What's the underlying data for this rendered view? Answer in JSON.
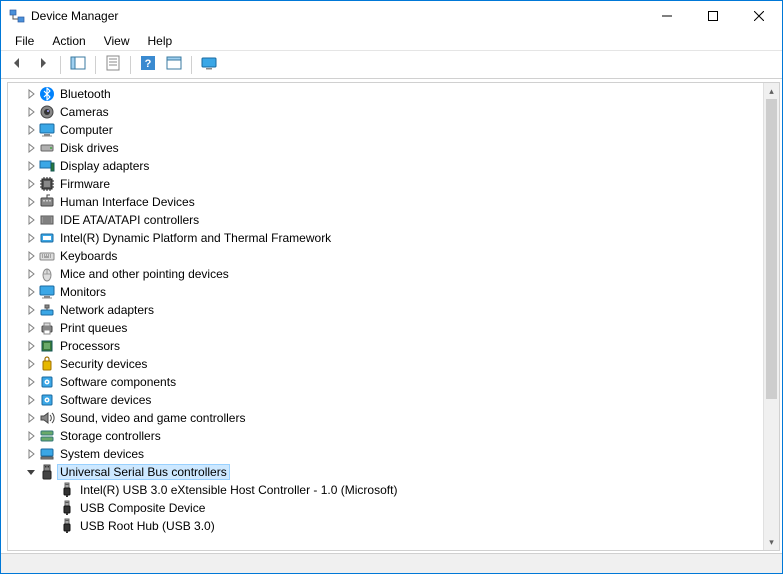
{
  "window": {
    "title": "Device Manager"
  },
  "menubar": {
    "items": [
      "File",
      "Action",
      "View",
      "Help"
    ]
  },
  "toolbar": {
    "buttons": [
      {
        "name": "back-button",
        "icon": "arrow-left-icon"
      },
      {
        "name": "forward-button",
        "icon": "arrow-right-icon"
      },
      {
        "name": "show-hide-tree-button",
        "icon": "panel-icon",
        "sep_before": true
      },
      {
        "name": "properties-button",
        "icon": "properties-icon",
        "sep_before": true
      },
      {
        "name": "help-button",
        "icon": "help-icon",
        "sep_before": true
      },
      {
        "name": "show-hidden-button",
        "icon": "show-hidden-icon"
      },
      {
        "name": "scan-button",
        "icon": "scan-icon",
        "sep_before": true
      }
    ]
  },
  "tree": {
    "nodes": [
      {
        "label": "Bluetooth",
        "icon": "bluetooth",
        "expandable": true,
        "expanded": false
      },
      {
        "label": "Cameras",
        "icon": "camera",
        "expandable": true,
        "expanded": false
      },
      {
        "label": "Computer",
        "icon": "monitor",
        "expandable": true,
        "expanded": false
      },
      {
        "label": "Disk drives",
        "icon": "disk",
        "expandable": true,
        "expanded": false
      },
      {
        "label": "Display adapters",
        "icon": "display-adapter",
        "expandable": true,
        "expanded": false
      },
      {
        "label": "Firmware",
        "icon": "chip",
        "expandable": true,
        "expanded": false
      },
      {
        "label": "Human Interface Devices",
        "icon": "hid",
        "expandable": true,
        "expanded": false
      },
      {
        "label": "IDE ATA/ATAPI controllers",
        "icon": "ide",
        "expandable": true,
        "expanded": false
      },
      {
        "label": "Intel(R) Dynamic Platform and Thermal Framework",
        "icon": "intel",
        "expandable": true,
        "expanded": false
      },
      {
        "label": "Keyboards",
        "icon": "keyboard",
        "expandable": true,
        "expanded": false
      },
      {
        "label": "Mice and other pointing devices",
        "icon": "mouse",
        "expandable": true,
        "expanded": false
      },
      {
        "label": "Monitors",
        "icon": "monitor",
        "expandable": true,
        "expanded": false
      },
      {
        "label": "Network adapters",
        "icon": "network",
        "expandable": true,
        "expanded": false
      },
      {
        "label": "Print queues",
        "icon": "printer",
        "expandable": true,
        "expanded": false
      },
      {
        "label": "Processors",
        "icon": "cpu",
        "expandable": true,
        "expanded": false
      },
      {
        "label": "Security devices",
        "icon": "security",
        "expandable": true,
        "expanded": false
      },
      {
        "label": "Software components",
        "icon": "software",
        "expandable": true,
        "expanded": false
      },
      {
        "label": "Software devices",
        "icon": "software",
        "expandable": true,
        "expanded": false
      },
      {
        "label": "Sound, video and game controllers",
        "icon": "sound",
        "expandable": true,
        "expanded": false
      },
      {
        "label": "Storage controllers",
        "icon": "storage",
        "expandable": true,
        "expanded": false
      },
      {
        "label": "System devices",
        "icon": "system",
        "expandable": true,
        "expanded": false
      },
      {
        "label": "Universal Serial Bus controllers",
        "icon": "usb",
        "expandable": true,
        "expanded": true,
        "selected": true,
        "children": [
          {
            "label": "Intel(R) USB 3.0 eXtensible Host Controller - 1.0 (Microsoft)",
            "icon": "usb-plug"
          },
          {
            "label": "USB Composite Device",
            "icon": "usb-plug"
          },
          {
            "label": "USB Root Hub (USB 3.0)",
            "icon": "usb-plug"
          }
        ]
      }
    ]
  }
}
